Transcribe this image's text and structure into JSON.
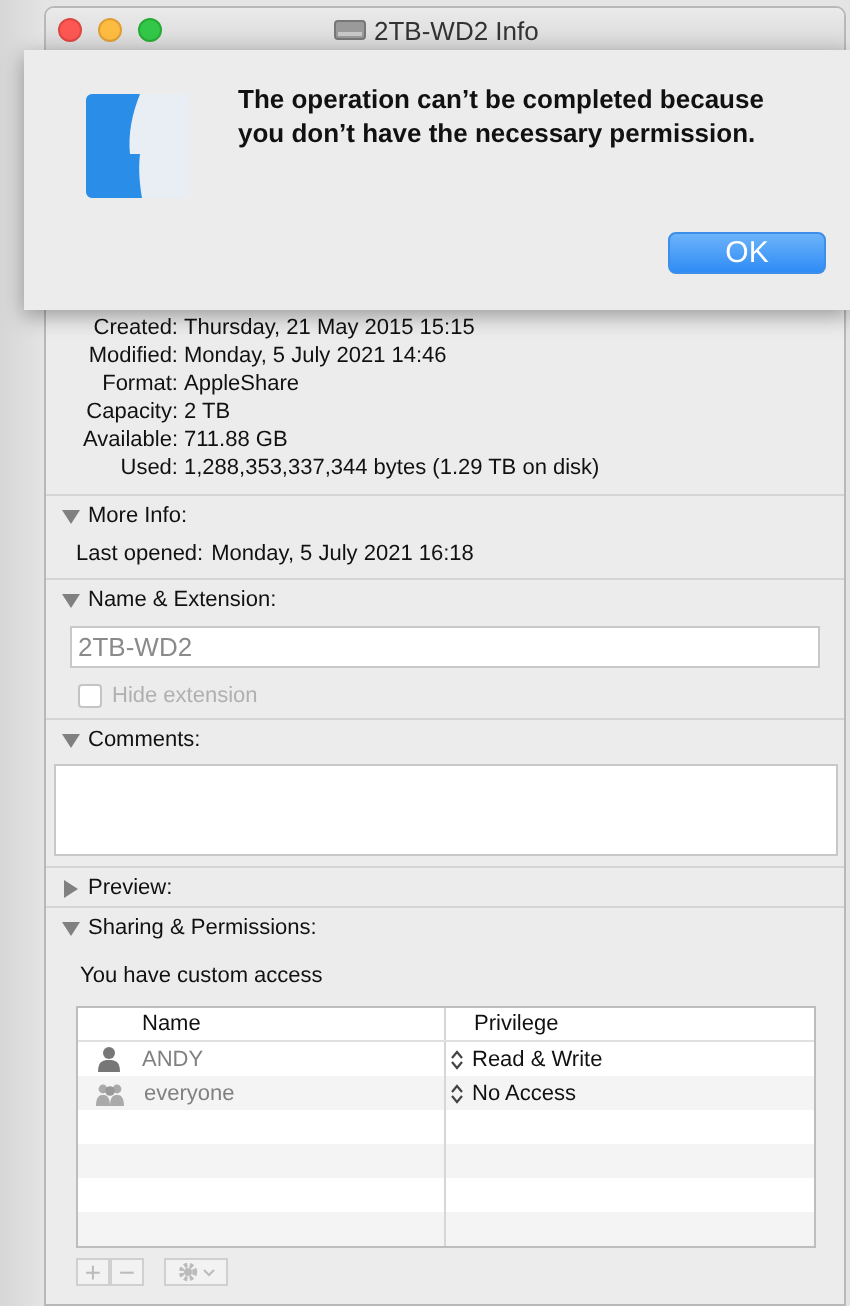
{
  "window": {
    "title": "2TB-WD2 Info"
  },
  "alert": {
    "message": "The operation can’t be completed because you don’t have the necessary permission.",
    "button": "OK"
  },
  "general": {
    "rows": [
      {
        "label": "Created:",
        "value": "Thursday, 21 May 2015 15:15"
      },
      {
        "label": "Modified:",
        "value": "Monday, 5 July 2021 14:46"
      },
      {
        "label": "Format:",
        "value": "AppleShare"
      },
      {
        "label": "Capacity:",
        "value": "2 TB"
      },
      {
        "label": "Available:",
        "value": "711.88 GB"
      },
      {
        "label": "Used:",
        "value": "1,288,353,337,344 bytes (1.29 TB on disk)"
      }
    ]
  },
  "sections": [
    {
      "kind": "more_info",
      "title": "More Info:",
      "expanded": true,
      "rows": [
        {
          "label": "Last opened:",
          "value": "Monday, 5 July 2021 16:18"
        }
      ]
    },
    {
      "kind": "name",
      "title": "Name & Extension:",
      "expanded": true,
      "field": {
        "value": "2TB-WD2",
        "disabled": true
      },
      "hide_extension": {
        "label": "Hide extension",
        "checked": false,
        "disabled": true
      }
    },
    {
      "kind": "comments",
      "title": "Comments:",
      "expanded": true
    },
    {
      "title": "Preview:",
      "expanded": false
    },
    {
      "kind": "sharing",
      "title": "Sharing & Permissions:",
      "expanded": true,
      "access_note": "You have custom access",
      "columns": [
        "Name",
        "Privilege"
      ],
      "rows": [
        {
          "name": "ANDY",
          "kind": "user",
          "privilege": "Read & Write"
        },
        {
          "name": "everyone",
          "kind": "group",
          "privilege": "No Access"
        }
      ],
      "buttons": [
        "+",
        "−"
      ]
    }
  ]
}
